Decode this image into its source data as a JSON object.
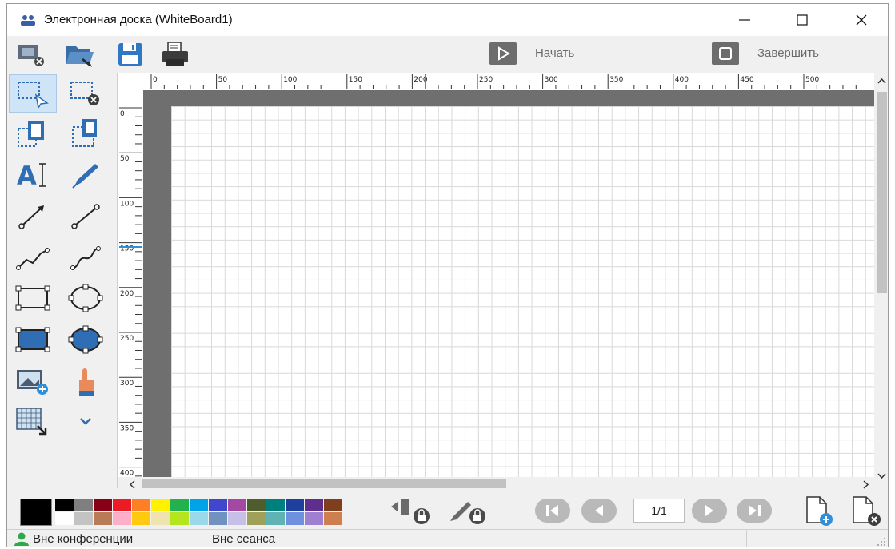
{
  "window": {
    "title": "Электронная доска (WhiteBoard1)",
    "controls": [
      "minimize",
      "maximize",
      "close"
    ]
  },
  "toolbar": {
    "icons": [
      "close-board-icon",
      "open-folder-icon",
      "save-icon",
      "print-icon"
    ],
    "start_label": "Начать",
    "stop_label": "Завершить"
  },
  "tools": [
    "select-area-icon",
    "delete-selection-icon",
    "copy-icon",
    "paste-icon",
    "text-tool-icon",
    "pen-tool-icon",
    "arrow-line-icon",
    "line-icon",
    "polyline-icon",
    "curve-icon",
    "rectangle-outline-icon",
    "ellipse-outline-icon",
    "rectangle-filled-icon",
    "ellipse-filled-icon",
    "insert-image-icon",
    "pointer-hand-icon",
    "grid-pattern-icon",
    "expand-more-icon"
  ],
  "rulers": {
    "top_labels": [
      "0",
      "50",
      "100",
      "150",
      "200",
      "250",
      "300",
      "350",
      "400",
      "450",
      "500"
    ],
    "left_labels": [
      "0",
      "50",
      "100",
      "150",
      "200",
      "250",
      "300",
      "350",
      "400"
    ]
  },
  "palette": {
    "current_color": "#000000",
    "colors": [
      "#000000",
      "#ffffff",
      "#7f7f7f",
      "#c3c3c3",
      "#880015",
      "#b97a57",
      "#ed1c24",
      "#ffaec9",
      "#ff7f27",
      "#ffc90e",
      "#fff200",
      "#efe4b0",
      "#22b14c",
      "#b5e61d",
      "#00a2e8",
      "#99d9ea",
      "#3f48cc",
      "#7092be",
      "#a349a4",
      "#c8bfe7",
      "#4e5d2b",
      "#a0a05a",
      "#007f7f",
      "#5fb3b3",
      "#1f3f9f",
      "#6f8fdf",
      "#5f2f8f",
      "#9f7fcf",
      "#7f3f1f",
      "#cf7f4f"
    ]
  },
  "page_nav": {
    "page_indicator": "1/1",
    "icons": [
      "first-page-icon",
      "prev-page-icon",
      "next-page-icon",
      "last-page-icon"
    ]
  },
  "status": {
    "conference": "Вне конференции",
    "session": "Вне сеанса"
  }
}
